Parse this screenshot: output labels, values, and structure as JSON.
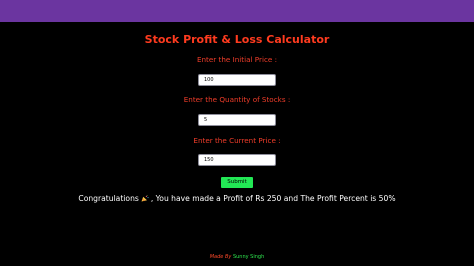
{
  "title": "Stock Profit & Loss Calculator",
  "fields": [
    {
      "label": "Enter the Initial Price :",
      "value": "100"
    },
    {
      "label": "Enter the Quantity of Stocks :",
      "value": "5"
    },
    {
      "label": "Enter the Current Price :",
      "value": "150"
    }
  ],
  "submit_label": "Submit",
  "result": {
    "prefix": "Congratulations",
    "icon": "celebration-emoji-icon",
    "message": ", You have made a Profit of Rs 250 and The Profit Percent is 50%"
  },
  "footer": {
    "label": "Made By",
    "author": "Sunny Singh"
  },
  "colors": {
    "header_bar": "#6b35a0",
    "background": "#000000",
    "title": "#ff3b1f",
    "labels": "#f03d2a",
    "submit": "#22e855",
    "footer_author": "#2fe84f"
  }
}
